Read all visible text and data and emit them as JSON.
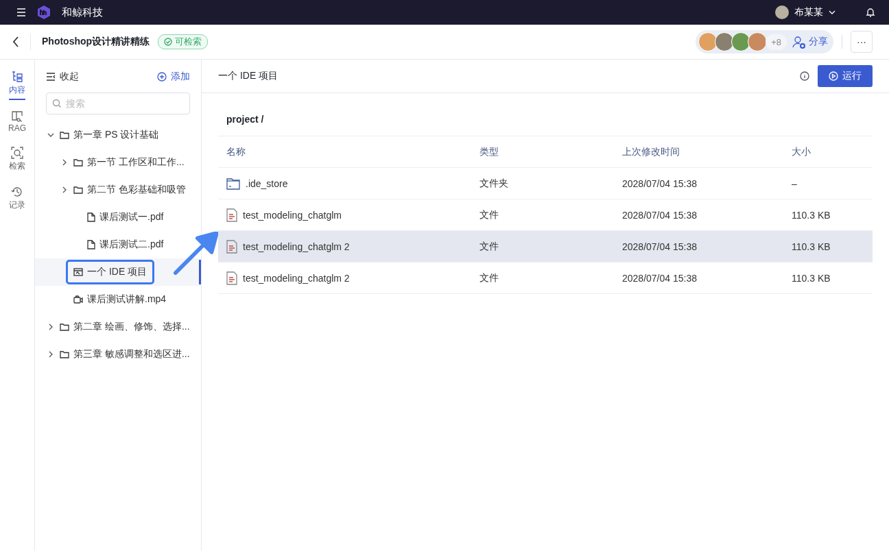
{
  "topbar": {
    "brand": "和鲸科技",
    "user": "布某某"
  },
  "header": {
    "title": "Photoshop设计精讲精练",
    "status": "可检索",
    "avatars": [
      {
        "color": "#e0a060"
      },
      {
        "color": "#8a8070"
      },
      {
        "color": "#6a9a50"
      },
      {
        "color": "#c98a60"
      }
    ],
    "more_count": "+8",
    "share": "分享",
    "more_button": "···"
  },
  "rail": [
    {
      "label": "内容",
      "selected": true
    },
    {
      "label": "RAG",
      "selected": false
    },
    {
      "label": "检索",
      "selected": false
    },
    {
      "label": "记录",
      "selected": false
    }
  ],
  "sidebar": {
    "collapse": "收起",
    "add": "添加",
    "search": {
      "placeholder": "搜索"
    },
    "tree": [
      {
        "kind": "folder",
        "label": "第一章 PS 设计基础",
        "expanded": true,
        "selected": false,
        "children": [
          {
            "kind": "folder",
            "label": "第一节 工作区和工作...",
            "expanded": false,
            "selected": false
          },
          {
            "kind": "folder",
            "label": "第二节 色彩基础和吸管",
            "expanded": false,
            "selected": false,
            "children": [
              {
                "kind": "file",
                "label": "课后测试一.pdf",
                "selected": false
              },
              {
                "kind": "file",
                "label": "课后测试二.pdf",
                "selected": false
              }
            ]
          },
          {
            "kind": "ide",
            "label": "一个 IDE 项目",
            "selected": true
          },
          {
            "kind": "video",
            "label": "课后测试讲解.mp4",
            "selected": false
          }
        ]
      },
      {
        "kind": "folder",
        "label": "第二章 绘画、修饰、选择...",
        "expanded": false,
        "selected": false
      },
      {
        "kind": "folder",
        "label": "第三章 敏感调整和选区进...",
        "expanded": false,
        "selected": false
      }
    ]
  },
  "main": {
    "title": "一个 IDE 项目",
    "run": "运行",
    "path": "project /",
    "table": {
      "columns": [
        "名称",
        "类型",
        "上次修改时间",
        "大小"
      ],
      "rows": [
        {
          "kind": "folder",
          "cells": [
            ".ide_store",
            "文件夹",
            "2028/07/04 15:38",
            "–"
          ],
          "selected": false
        },
        {
          "kind": "file",
          "cells": [
            "test_modeling_chatglm",
            "文件",
            "2028/07/04 15:38",
            "110.3 KB"
          ],
          "selected": false
        },
        {
          "kind": "file",
          "cells": [
            "test_modeling_chatglm 2",
            "文件",
            "2028/07/04 15:38",
            "110.3 KB"
          ],
          "selected": true
        },
        {
          "kind": "file",
          "cells": [
            "test_modeling_chatglm 2",
            "文件",
            "2028/07/04 15:38",
            "110.3 KB"
          ],
          "selected": false
        }
      ]
    }
  }
}
